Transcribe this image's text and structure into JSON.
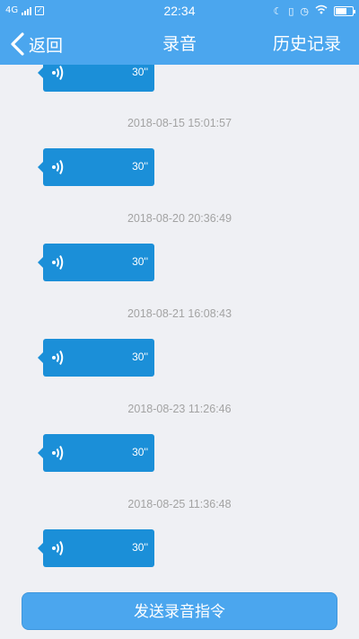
{
  "status_bar": {
    "network": "4G",
    "time": "22:34"
  },
  "header": {
    "back_label": "返回",
    "title": "录音",
    "history_label": "历史记录"
  },
  "recordings": [
    {
      "timestamp": "",
      "duration": "30''"
    },
    {
      "timestamp": "2018-08-15 15:01:57",
      "duration": "30''"
    },
    {
      "timestamp": "2018-08-20 20:36:49",
      "duration": "30''"
    },
    {
      "timestamp": "2018-08-21 16:08:43",
      "duration": "30''"
    },
    {
      "timestamp": "2018-08-23 11:26:46",
      "duration": "30''"
    },
    {
      "timestamp": "2018-08-25 11:36:48",
      "duration": "30''"
    }
  ],
  "send_button_label": "发送录音指令",
  "colors": {
    "primary": "#4ba6ee",
    "bubble": "#1b8fd8",
    "background": "#eff0f4",
    "timestamp_text": "#a3a3a3"
  }
}
